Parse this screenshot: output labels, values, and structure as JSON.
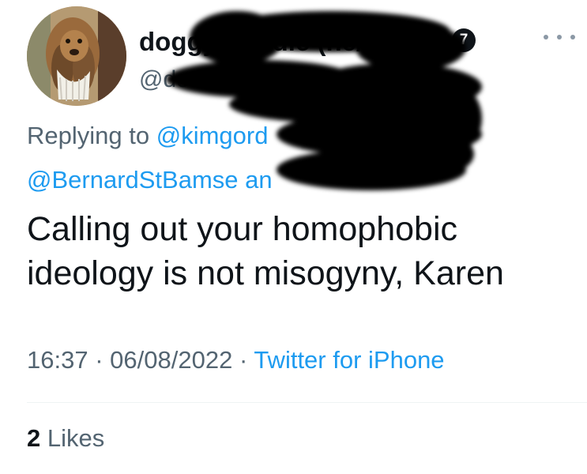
{
  "tweet": {
    "author": {
      "display_name": "doggy noodle (he/him)",
      "handle": "@doodle",
      "badge": "7"
    },
    "replying_to": {
      "prefix": "Replying to",
      "mention_1": "@kimgord",
      "mention_2": "@BernardStBamse an"
    },
    "text": "Calling out your homophobic ideology is not misogyny, Karen",
    "time": "16:37",
    "date": "06/08/2022",
    "separator": "·",
    "source": "Twitter for iPhone",
    "likes": {
      "count": "2",
      "label": "Likes"
    }
  },
  "icons": {
    "more": "more-horizontal-icon",
    "verified": "badge-icon"
  },
  "colors": {
    "link": "#1d9bf0",
    "secondary": "#536471",
    "text": "#0f1419"
  }
}
